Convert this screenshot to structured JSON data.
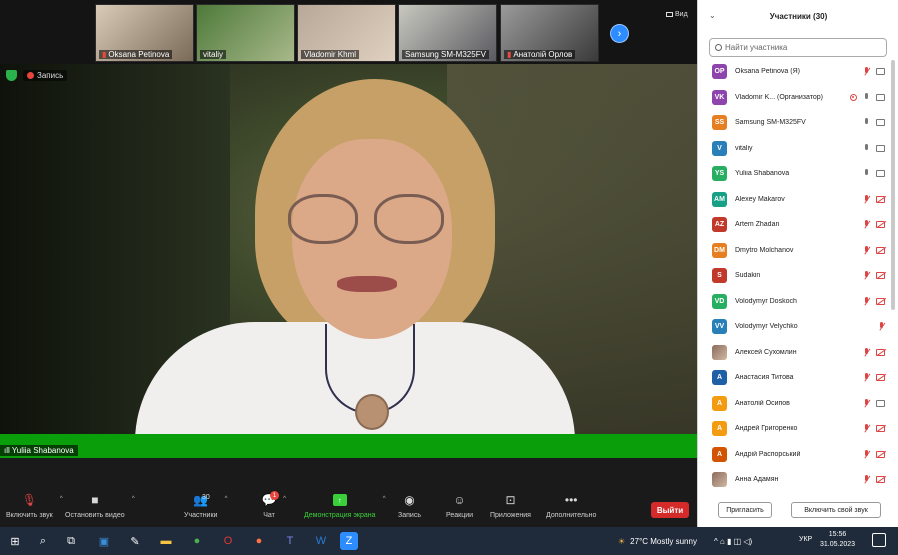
{
  "colors": {
    "accent": "#2d8cff",
    "leave": "#d42a2a",
    "active_speaker_bar": "#0a9e0a",
    "muted": "#dd4444"
  },
  "gallery": {
    "thumbnails": [
      {
        "name": "Oksana Petinova",
        "muted": true
      },
      {
        "name": "vitaliy",
        "muted": false
      },
      {
        "name": "Vladomir Khml",
        "muted": false
      },
      {
        "name": "Samsung SM-M325FV",
        "muted": false
      },
      {
        "name": "Анатолій Орлов",
        "muted": true
      }
    ],
    "next_icon": "chevron-right-icon",
    "view_label": "Вид"
  },
  "status": {
    "recording_label": "Запись"
  },
  "speaker": {
    "name": "Yuliia Shabanova"
  },
  "toolbar": {
    "unmute": "Включить звук",
    "stop_video": "Остановить видео",
    "participants": "Участники",
    "participants_count": "30",
    "chat": "Чат",
    "chat_badge": "1",
    "share": "Демонстрация экрана",
    "record": "Запись",
    "reactions": "Реакции",
    "apps": "Приложения",
    "more": "Дополнительно",
    "leave": "Выйти"
  },
  "panel": {
    "title": "Участники (30)",
    "search_placeholder": "Найти участника",
    "participants": [
      {
        "initials": "OP",
        "name": "Oksana Petinova (Я)",
        "color": "#8e44ad",
        "mic": "muted",
        "video": "on"
      },
      {
        "initials": "VK",
        "name": "Vladomir K... (Организатор)",
        "color": "#8e44ad",
        "mic": "on",
        "video": "on",
        "recording": true
      },
      {
        "initials": "SS",
        "name": "Samsung SM-M325FV",
        "color": "#e67e22",
        "mic": "on",
        "video": "on"
      },
      {
        "initials": "V",
        "name": "vitaliy",
        "color": "#2980b9",
        "mic": "on",
        "video": "on"
      },
      {
        "initials": "YS",
        "name": "Yuliia Shabanova",
        "color": "#27ae60",
        "mic": "speaking",
        "video": "on"
      },
      {
        "initials": "AM",
        "name": "Alexey Makarov",
        "color": "#16a085",
        "mic": "muted",
        "video": "off"
      },
      {
        "initials": "AZ",
        "name": "Artem Zhadan",
        "color": "#c0392b",
        "mic": "muted",
        "video": "off"
      },
      {
        "initials": "DM",
        "name": "Dmytro Molchanov",
        "color": "#e67e22",
        "mic": "muted",
        "video": "off"
      },
      {
        "initials": "S",
        "name": "Sudakin",
        "color": "#c0392b",
        "mic": "muted",
        "video": "off"
      },
      {
        "initials": "VD",
        "name": "Volodymyr Doskoch",
        "color": "#27ae60",
        "mic": "muted",
        "video": "off"
      },
      {
        "initials": "VV",
        "name": "Volodymyr Velychko",
        "color": "#2980b9",
        "mic": "muted",
        "video": "none"
      },
      {
        "initials": "",
        "name": "Алексей Сухомлин",
        "color": "photo",
        "mic": "muted",
        "video": "off"
      },
      {
        "initials": "A",
        "name": "Анастасия Титова",
        "color": "#1f5fa6",
        "mic": "muted",
        "video": "off"
      },
      {
        "initials": "A",
        "name": "Анатолій Осипов",
        "color": "#f39c12",
        "mic": "muted",
        "video": "on"
      },
      {
        "initials": "A",
        "name": "Андрей Григоренко",
        "color": "#f39c12",
        "mic": "muted",
        "video": "off"
      },
      {
        "initials": "A",
        "name": "Андрій Распорський",
        "color": "#d35400",
        "mic": "muted",
        "video": "off"
      },
      {
        "initials": "",
        "name": "Анна Адамян",
        "color": "photo",
        "mic": "muted",
        "video": "off"
      }
    ],
    "invite": "Пригласить",
    "unmute_self": "Включить свой звук"
  },
  "taskbar": {
    "weather": "27°C  Mostly sunny",
    "lang": "УКР",
    "time": "15:56",
    "date": "31.05.2023"
  }
}
